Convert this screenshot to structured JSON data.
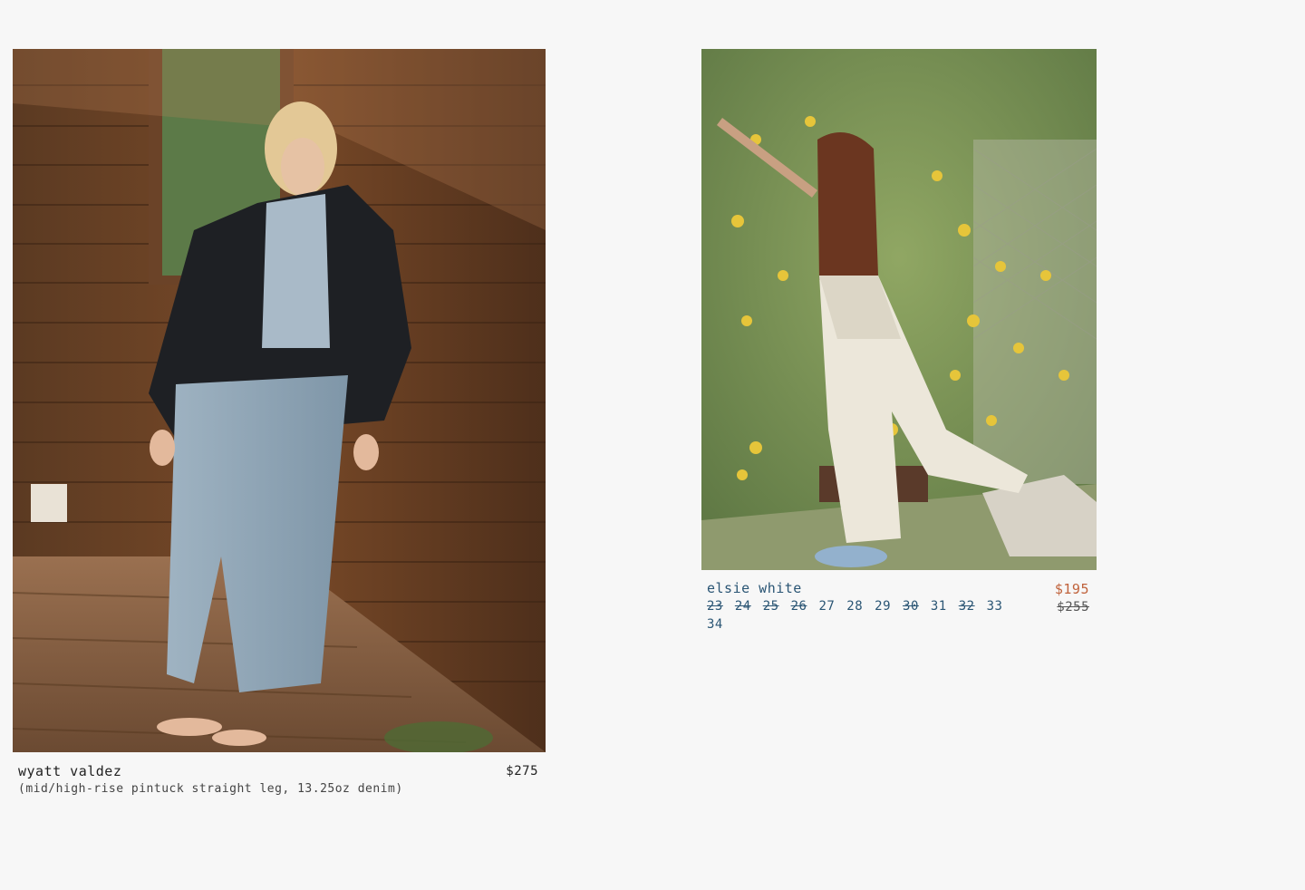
{
  "products": [
    {
      "name": "wyatt valdez",
      "description": "(mid/high-rise pintuck straight leg, 13.25oz denim)",
      "price": "$275",
      "image_alt": "woman in cardigan and light wash jeans leaning on wooden wall"
    },
    {
      "name": "elsie white",
      "sale_price": "$195",
      "original_price": "$255",
      "sizes": [
        {
          "label": "23",
          "sold_out": true
        },
        {
          "label": "24",
          "sold_out": true
        },
        {
          "label": "25",
          "sold_out": true
        },
        {
          "label": "26",
          "sold_out": true
        },
        {
          "label": "27",
          "sold_out": false
        },
        {
          "label": "28",
          "sold_out": false
        },
        {
          "label": "29",
          "sold_out": false
        },
        {
          "label": "30",
          "sold_out": true
        },
        {
          "label": "31",
          "sold_out": false
        },
        {
          "label": "32",
          "sold_out": true
        },
        {
          "label": "33",
          "sold_out": false
        },
        {
          "label": "34",
          "sold_out": false
        }
      ],
      "image_alt": "woman in white jeans reaching into a lemon tree"
    }
  ],
  "colors": {
    "background": "#f7f7f7",
    "link_blue": "#2a5574",
    "sale_orange": "#c0623b"
  }
}
